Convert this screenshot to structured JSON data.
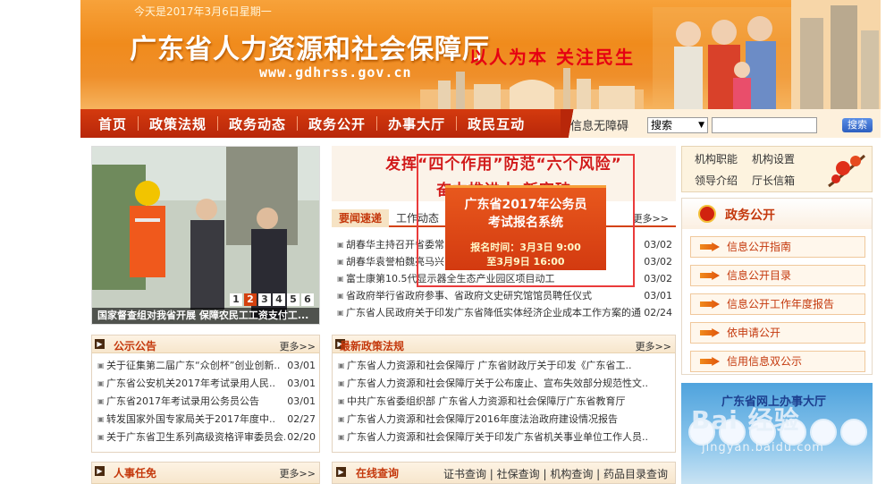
{
  "header": {
    "date": "今天是2017年3月6日星期一",
    "title": "广东省人力资源和社会保障厅",
    "url": "www.gdhrss.gov.cn",
    "slogan": "以人为本  关注民生"
  },
  "nav": {
    "items": [
      "首页",
      "政策法规",
      "政务动态",
      "政务公开",
      "办事大厅",
      "政民互动"
    ],
    "accessibility": "信息无障碍",
    "search_select": "搜索",
    "search_button": "搜索"
  },
  "slider": {
    "pages": [
      "1",
      "2",
      "3",
      "4",
      "5",
      "6"
    ],
    "active_page": "2",
    "caption": "国家督查组对我省开展  保障农民工工资支付工..."
  },
  "banner": {
    "line1": "发挥“四个作用”防范“六个风险”",
    "line2": "奋力推进人                               新突破"
  },
  "popup": {
    "title1": "广东省2017年公务员",
    "title2": "考试报名系统",
    "time1": "报名时间：3月3日 9:00",
    "time2": "至3月9日 16:00"
  },
  "news": {
    "tab_active": "要闻速递",
    "tab_other": "工作动态",
    "more": "更多>>",
    "items": [
      {
        "text": "胡春华主持召开省委常",
        "date": "03/02"
      },
      {
        "text": "胡春华袁誉柏魏亮马兴",
        "date": "03/02"
      },
      {
        "text": "富士康第10.5代显示器全生态产业园区项目动工",
        "date": "03/02"
      },
      {
        "text": "省政府举行省政府参事、省政府文史研究馆馆员聘任仪式",
        "date": "03/01"
      },
      {
        "text": "广东省人民政府关于印发广东省降低实体经济企业成本工作方案的通",
        "date": "02/24"
      }
    ]
  },
  "notice": {
    "title": "公示公告",
    "more": "更多>>",
    "items": [
      {
        "text": "关于征集第二届广东“众创杯”创业创新..",
        "date": "03/01"
      },
      {
        "text": "广东省公安机关2017年考试录用人民..",
        "date": "03/01"
      },
      {
        "text": "广东省2017年考试录用公务员公告",
        "date": "03/01"
      },
      {
        "text": "转发国家外国专家局关于2017年度中..",
        "date": "02/27"
      },
      {
        "text": "关于广东省卫生系列高级资格评审委员会..",
        "date": "02/20"
      }
    ]
  },
  "policy": {
    "title": "最新政策法规",
    "more": "更多>>",
    "items": [
      "广东省人力资源和社会保障厅 广东省财政厅关于印发《广东省工..",
      "广东省人力资源和社会保障厅关于公布废止、宣布失效部分规范性文..",
      "中共广东省委组织部 广东省人力资源和社会保障厅广东省教育厅",
      "广东省人力资源和社会保障厅2016年度法治政府建设情况报告",
      "广东省人力资源和社会保障厅关于印发广东省机关事业单位工作人员.."
    ]
  },
  "personnel": {
    "title": "人事任免",
    "more": "更多>>"
  },
  "online": {
    "title": "在线查询",
    "links": "证书查询 | 社保查询 | 机构查询 | 药品目录查询"
  },
  "org": {
    "links": [
      "机构职能",
      "机构设置",
      "领导介绍",
      "厅长信箱"
    ]
  },
  "gov": {
    "title": "政务公开",
    "buttons": [
      "信息公开指南",
      "信息公开目录",
      "信息公开工作年度报告",
      "依申请公开",
      "信用信息双公示"
    ]
  },
  "hall": {
    "title": "广东省网上办事大厅"
  },
  "watermark": {
    "text": "Bai  经验",
    "url": "jingyan.baidu.com"
  }
}
